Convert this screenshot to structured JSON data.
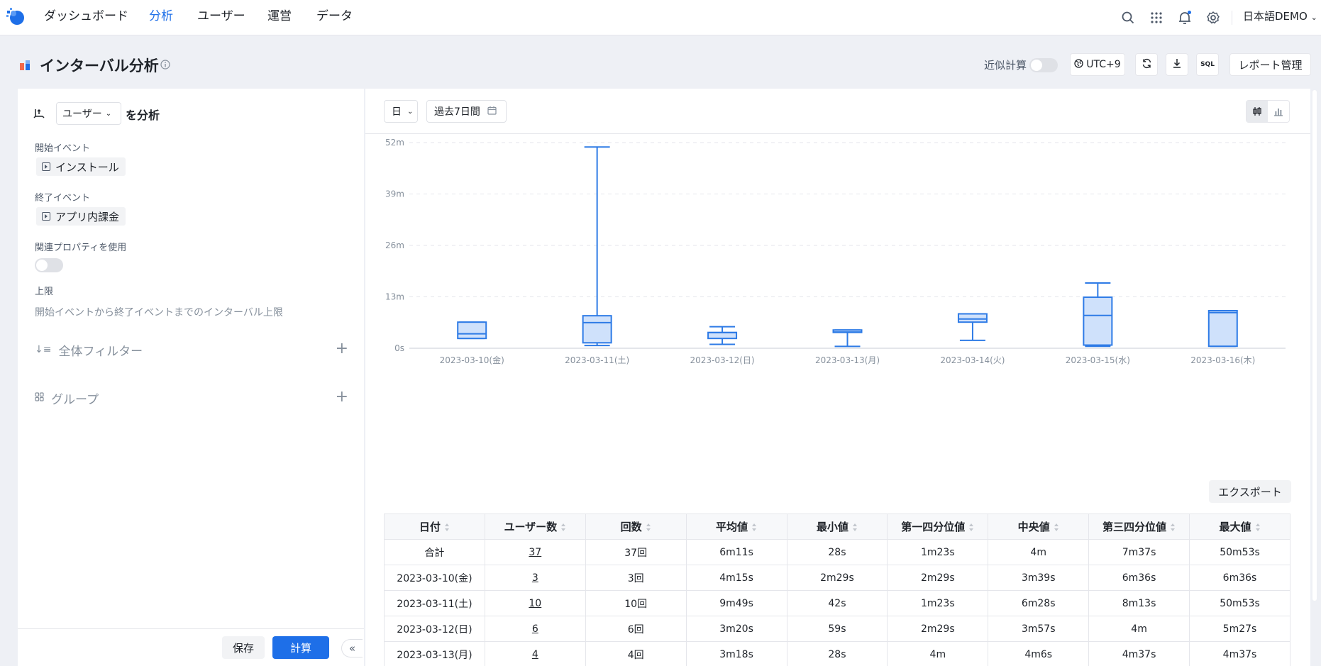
{
  "nav": {
    "items": [
      "ダッシュボード",
      "分析",
      "ユーザー",
      "運営",
      "データ"
    ],
    "active_index": 1,
    "language": "日本語DEMO"
  },
  "header": {
    "title": "インターバル分析",
    "approx_label": "近似計算",
    "approx_enabled": false,
    "timezone": "UTC+9",
    "sql_label": "SQL",
    "report_button": "レポート管理"
  },
  "left": {
    "subject": "ユーザー",
    "analyze_suffix": "を分析",
    "start_label": "開始イベント",
    "start_event": "インストール",
    "end_label": "終了イベント",
    "end_event": "アプリ内課金",
    "related_label": "関連プロパティを使用",
    "related_enabled": false,
    "limit_label": "上限",
    "limit_placeholder": "開始イベントから終了イベントまでのインターバル上限",
    "filter_label": "全体フィルター",
    "group_label": "グループ",
    "save": "保存",
    "calc": "計算",
    "collapse": "«"
  },
  "toolbar": {
    "granularity": "日",
    "date_range": "過去7日間"
  },
  "chart_data": {
    "type": "boxplot",
    "unit": "minutes",
    "y_ticks": [
      "0s",
      "13m",
      "26m",
      "39m",
      "52m"
    ],
    "ylim": [
      0,
      52
    ],
    "grid": true,
    "categories": [
      "2023-03-10(金)",
      "2023-03-11(土)",
      "2023-03-12(日)",
      "2023-03-13(月)",
      "2023-03-14(火)",
      "2023-03-15(水)",
      "2023-03-16(木)"
    ],
    "series": [
      {
        "min": 2.48,
        "q1": 2.48,
        "median": 3.65,
        "q3": 6.6,
        "max": 6.6
      },
      {
        "min": 0.7,
        "q1": 1.38,
        "median": 6.47,
        "q3": 8.22,
        "max": 50.88
      },
      {
        "min": 0.98,
        "q1": 2.48,
        "median": 3.95,
        "q3": 4.0,
        "max": 5.45
      },
      {
        "min": 0.47,
        "q1": 4.0,
        "median": 4.1,
        "q3": 4.62,
        "max": 4.62
      },
      {
        "min": 2.0,
        "q1": 6.6,
        "median": 7.4,
        "q3": 8.7,
        "max": 8.7
      },
      {
        "min": 0.5,
        "q1": 0.8,
        "median": 8.3,
        "q3": 12.9,
        "max": 16.5
      },
      {
        "min": 0.5,
        "q1": 0.5,
        "median": 9.0,
        "q3": 9.5,
        "max": 9.5
      }
    ]
  },
  "table": {
    "export_label": "エクスポート",
    "headers": [
      "日付",
      "ユーザー数",
      "回数",
      "平均値",
      "最小値",
      "第一四分位値",
      "中央値",
      "第三四分位値",
      "最大値"
    ],
    "rows": [
      [
        "合計",
        "37",
        "37回",
        "6m11s",
        "28s",
        "1m23s",
        "4m",
        "7m37s",
        "50m53s"
      ],
      [
        "2023-03-10(金)",
        "3",
        "3回",
        "4m15s",
        "2m29s",
        "2m29s",
        "3m39s",
        "6m36s",
        "6m36s"
      ],
      [
        "2023-03-11(土)",
        "10",
        "10回",
        "9m49s",
        "42s",
        "1m23s",
        "6m28s",
        "8m13s",
        "50m53s"
      ],
      [
        "2023-03-12(日)",
        "6",
        "6回",
        "3m20s",
        "59s",
        "2m29s",
        "3m57s",
        "4m",
        "5m27s"
      ],
      [
        "2023-03-13(月)",
        "4",
        "4回",
        "3m18s",
        "28s",
        "4m",
        "4m6s",
        "4m37s",
        "4m37s"
      ]
    ]
  },
  "colors": {
    "accent": "#1e6fe8",
    "box_fill": "#cfe1fb",
    "box_stroke": "#2e7be6"
  }
}
